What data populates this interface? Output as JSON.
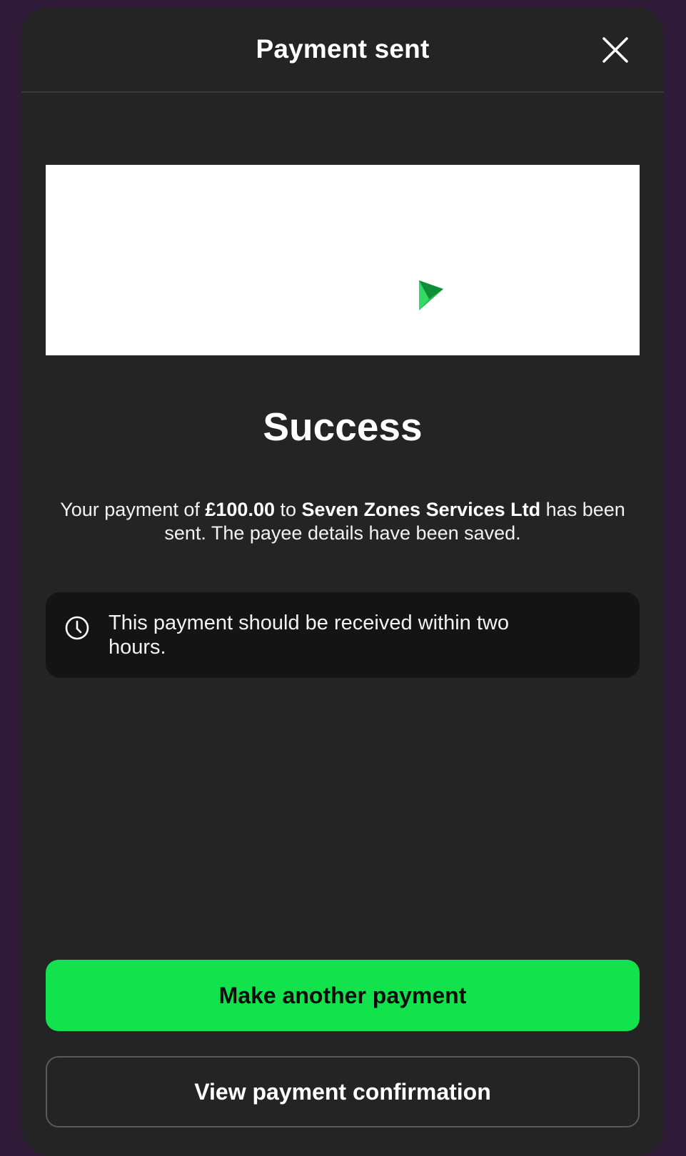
{
  "header": {
    "title": "Payment sent",
    "close_icon": "close-icon"
  },
  "banner": {
    "icon": "paper-plane-icon",
    "icon_colors": [
      "#1fc24a",
      "#0e8f36"
    ]
  },
  "result": {
    "title": "Success",
    "message_prefix": "Your payment of ",
    "amount": "£100.00",
    "message_mid": " to ",
    "payee": "Seven Zones Services Ltd",
    "message_suffix": " has been sent. The payee details have been saved."
  },
  "info": {
    "icon": "clock-icon",
    "text": "This payment should be received within two hours."
  },
  "actions": {
    "primary_label": "Make another payment",
    "secondary_label": "View payment confirmation"
  },
  "colors": {
    "accent": "#12e34d",
    "background": "#2f1a38",
    "surface": "#242424",
    "info_surface": "#141414"
  }
}
